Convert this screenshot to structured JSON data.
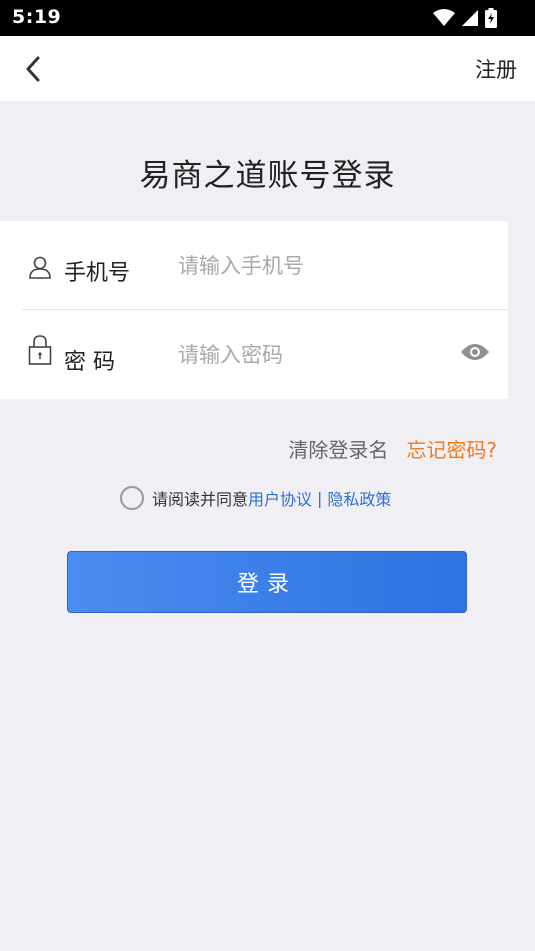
{
  "status_bar": {
    "time": "5:19",
    "icons": [
      "wifi-icon",
      "signal-icon",
      "battery-charging-icon"
    ]
  },
  "nav": {
    "back_icon": "chevron-left-icon",
    "register_label": "注册"
  },
  "title": "易商之道账号登录",
  "form": {
    "phone": {
      "icon": "user-icon",
      "label": "手机号",
      "placeholder": "请输入手机号",
      "value": ""
    },
    "password": {
      "icon": "lock-icon",
      "label": "密 码",
      "placeholder": "请输入密码",
      "value": "",
      "toggle_icon": "eye-icon"
    }
  },
  "links": {
    "clear_login_name": "清除登录名",
    "forgot_password": "忘记密码?"
  },
  "agreement": {
    "checked": false,
    "prefix": "请阅读并同意",
    "user_agreement": "用户协议",
    "separator": "|",
    "privacy_policy": "隐私政策"
  },
  "login_button_label": "登录",
  "colors": {
    "background": "#efeff4",
    "accent_blue": "#3a7de8",
    "link_orange": "#f07a1d",
    "link_blue": "#2f6fd6"
  }
}
